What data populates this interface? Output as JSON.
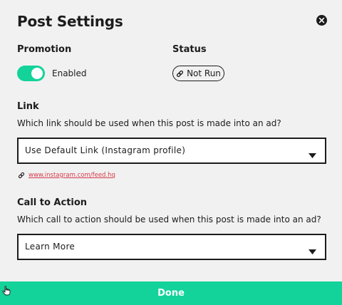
{
  "modal": {
    "title": "Post Settings",
    "close_icon": "close-circle-icon"
  },
  "promotion": {
    "label": "Promotion",
    "toggle_state": "on",
    "toggle_text": "Enabled",
    "colors": {
      "accent": "#13d39a"
    }
  },
  "status": {
    "label": "Status",
    "icon": "link-icon",
    "value": "Not Run"
  },
  "link": {
    "label": "Link",
    "description": "Which link should be used when this post is made into an ad?",
    "selected": "Use Default Link (Instagram profile)",
    "url_icon": "link-icon",
    "url": "www.instagram.com/feed.hq",
    "url_color": "#d63a4a"
  },
  "cta": {
    "label": "Call to Action",
    "description": "Which call to action should be used when this post is made into an ad?",
    "selected": "Learn More"
  },
  "footer": {
    "done_label": "Done",
    "color": "#13d39a"
  }
}
